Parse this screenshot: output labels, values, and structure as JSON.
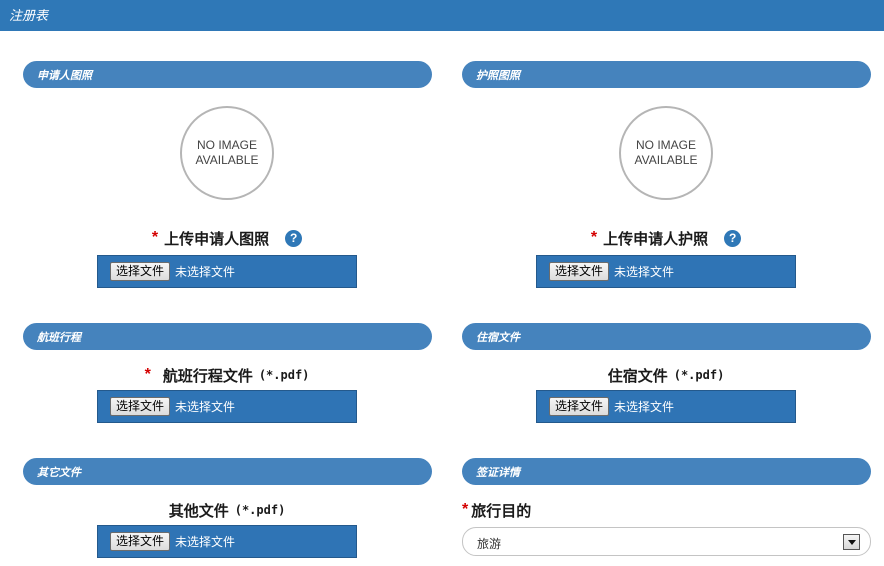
{
  "topbar": {
    "title": "注册表"
  },
  "sections": {
    "photo": {
      "header": "申请人图照",
      "no_image_line1": "NO IMAGE",
      "no_image_line2": "AVAILABLE",
      "label": "上传申请人图照",
      "required": "*",
      "help": "?"
    },
    "passport": {
      "header": "护照图照",
      "no_image_line1": "NO IMAGE",
      "no_image_line2": "AVAILABLE",
      "label": "上传申请人护照",
      "required": "*",
      "help": "?"
    },
    "flight": {
      "header": "航班行程",
      "label": "航班行程文件",
      "ext": "(*.pdf)",
      "required": "*"
    },
    "hotel": {
      "header": "住宿文件",
      "label": "住宿文件",
      "ext": "(*.pdf)"
    },
    "other": {
      "header": "其它文件",
      "label": "其他文件",
      "ext": "(*.pdf)"
    },
    "visa": {
      "header": "签证详情",
      "label": "旅行目的",
      "required": "*",
      "purpose_value": "旅游"
    }
  },
  "file_input": {
    "button_label": "选择文件",
    "status": "未选择文件"
  },
  "colors": {
    "header_bar": "#2f78b7",
    "section_header": "#4583bd",
    "file_box": "#2f74b5",
    "required": "#d40000"
  }
}
